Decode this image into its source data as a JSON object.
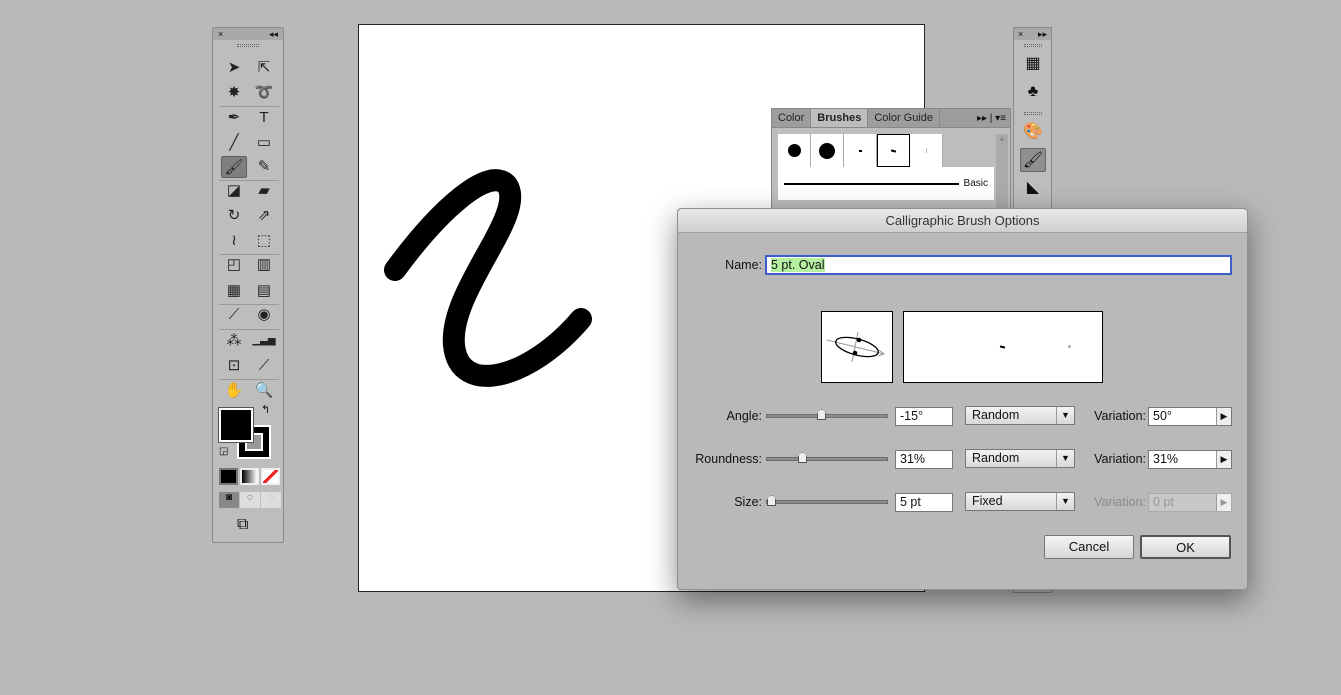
{
  "toolbar": {
    "close": "×",
    "collapse": "◂◂",
    "tools": [
      {
        "name": "selection-tool",
        "glyph": "➤"
      },
      {
        "name": "direct-selection-tool",
        "glyph": "⇱"
      },
      {
        "name": "magic-wand-tool",
        "glyph": "✸"
      },
      {
        "name": "lasso-tool",
        "glyph": "➰"
      },
      {
        "name": "pen-tool",
        "glyph": "✒"
      },
      {
        "name": "type-tool",
        "glyph": "T"
      },
      {
        "name": "line-tool",
        "glyph": "╱"
      },
      {
        "name": "rectangle-tool",
        "glyph": "▭"
      },
      {
        "name": "paintbrush-tool",
        "glyph": "🖌"
      },
      {
        "name": "pencil-tool",
        "glyph": "✎"
      },
      {
        "name": "blob-brush-tool",
        "glyph": "◪"
      },
      {
        "name": "eraser-tool",
        "glyph": "▰"
      },
      {
        "name": "rotate-tool",
        "glyph": "↻"
      },
      {
        "name": "scale-tool",
        "glyph": "⇗"
      },
      {
        "name": "warp-tool",
        "glyph": "≀"
      },
      {
        "name": "free-transform-tool",
        "glyph": "⬚"
      },
      {
        "name": "shape-builder-tool",
        "glyph": "◰"
      },
      {
        "name": "perspective-grid-tool",
        "glyph": "▥"
      },
      {
        "name": "mesh-tool",
        "glyph": "▦"
      },
      {
        "name": "gradient-tool",
        "glyph": "▤"
      },
      {
        "name": "eyedropper-tool",
        "glyph": "⟋"
      },
      {
        "name": "blend-tool",
        "glyph": "◉"
      },
      {
        "name": "symbol-sprayer-tool",
        "glyph": "⁂"
      },
      {
        "name": "column-graph-tool",
        "glyph": "▁▃▅"
      },
      {
        "name": "artboard-tool",
        "glyph": "⊡"
      },
      {
        "name": "slice-tool",
        "glyph": "⟋"
      },
      {
        "name": "hand-tool",
        "glyph": "✋"
      },
      {
        "name": "zoom-tool",
        "glyph": "🔍"
      }
    ]
  },
  "brushes_panel": {
    "tabs": [
      "Color",
      "Brushes",
      "Color Guide"
    ],
    "basic_label": "Basic"
  },
  "right_strip": {
    "close": "×",
    "collapse": "▸▸"
  },
  "dialog": {
    "title": "Calligraphic Brush Options",
    "name_label": "Name:",
    "name_value": "5 pt. Oval",
    "rows": [
      {
        "label": "Angle:",
        "value": "-15°",
        "mode": "Random",
        "variation_label": "Variation:",
        "variation": "50°",
        "slider": 0.5,
        "disabled": false
      },
      {
        "label": "Roundness:",
        "value": "31%",
        "mode": "Random",
        "variation_label": "Variation:",
        "variation": "31%",
        "slider": 0.31,
        "disabled": false
      },
      {
        "label": "Size:",
        "value": "5 pt",
        "mode": "Fixed",
        "variation_label": "Variation:",
        "variation": "0 pt",
        "slider": 0.0,
        "disabled": true
      }
    ],
    "cancel": "Cancel",
    "ok": "OK"
  }
}
